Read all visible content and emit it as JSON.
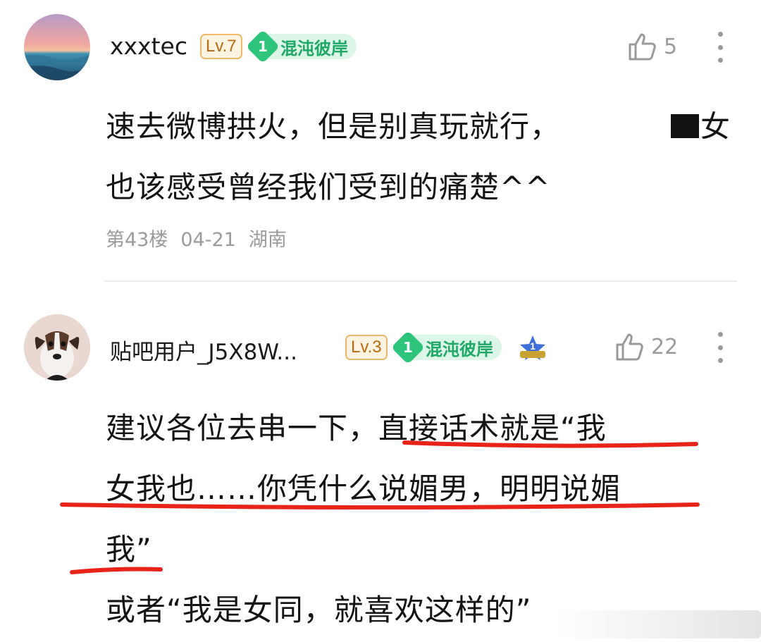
{
  "posts": [
    {
      "username": "xxxtec",
      "level": "Lv.7",
      "badge_num": "1",
      "badge_text": "混沌彼岸",
      "likes": "5",
      "lines": [
        "速去微博拱火，但是别真玩就行，",
        "也该感受曾经我们受到的痛楚^^"
      ],
      "redacted_tail": "女",
      "floor": "第43楼",
      "date": "04-21",
      "location": "湖南"
    },
    {
      "username": "贴吧用户_J5X8W...",
      "level": "Lv.3",
      "badge_num": "1",
      "badge_text": "混沌彼岸",
      "likes": "22",
      "lines": [
        "建议各位去串一下，直接话术就是“我",
        "女我也……你凭什么说媚男，明明说媚",
        "我”",
        "或者“我是女同，就喜欢这样的”"
      ]
    }
  ],
  "colors": {
    "underline": "#e8231a",
    "badge_green": "#2fc47c",
    "level_orange": "#b86b12"
  },
  "icons": [
    "avatar-sunset",
    "avatar-dog",
    "thumb-up-icon",
    "more-icon",
    "star-rank-icon"
  ]
}
